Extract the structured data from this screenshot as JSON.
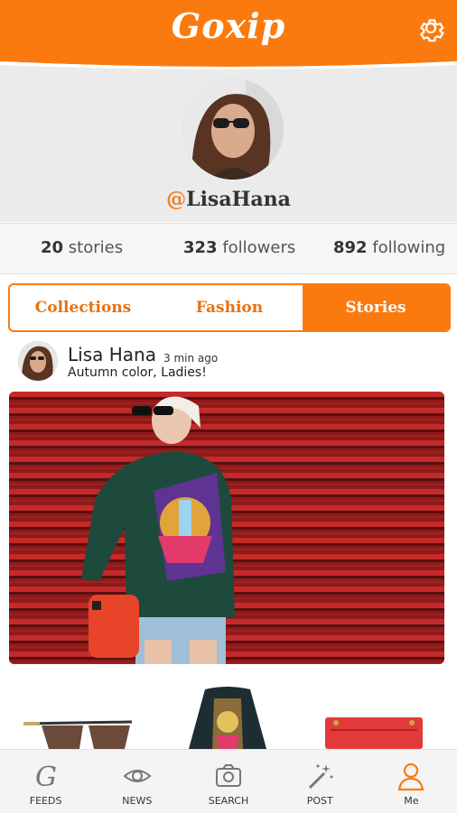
{
  "app": {
    "logo_text": "Goxip"
  },
  "icons": {
    "settings": "gear-icon"
  },
  "profile": {
    "username_at": "@",
    "username": "LisaHana"
  },
  "stats": {
    "stories": {
      "count": "20",
      "label": "stories"
    },
    "followers": {
      "count": "323",
      "label": "followers"
    },
    "following": {
      "count": "892",
      "label": "following"
    }
  },
  "tabs": [
    {
      "label": "Collections"
    },
    {
      "label": "Fashion"
    },
    {
      "label": "Stories"
    }
  ],
  "active_tab": "Stories",
  "post": {
    "author": "Lisa Hana",
    "time": "3 min ago",
    "caption": "Autumn color, Ladies!"
  },
  "products": [
    "sunglasses",
    "sweater",
    "red-bag"
  ],
  "bottom_nav": [
    {
      "label": "FEEDS",
      "icon": "feeds-icon"
    },
    {
      "label": "NEWS",
      "icon": "eye-icon"
    },
    {
      "label": "SEARCH",
      "icon": "camera-icon"
    },
    {
      "label": "POST",
      "icon": "magic-wand-icon"
    },
    {
      "label": "Me",
      "icon": "user-icon"
    }
  ],
  "colors": {
    "accent": "#fb7a10",
    "profile_bg": "#ebebeb"
  }
}
